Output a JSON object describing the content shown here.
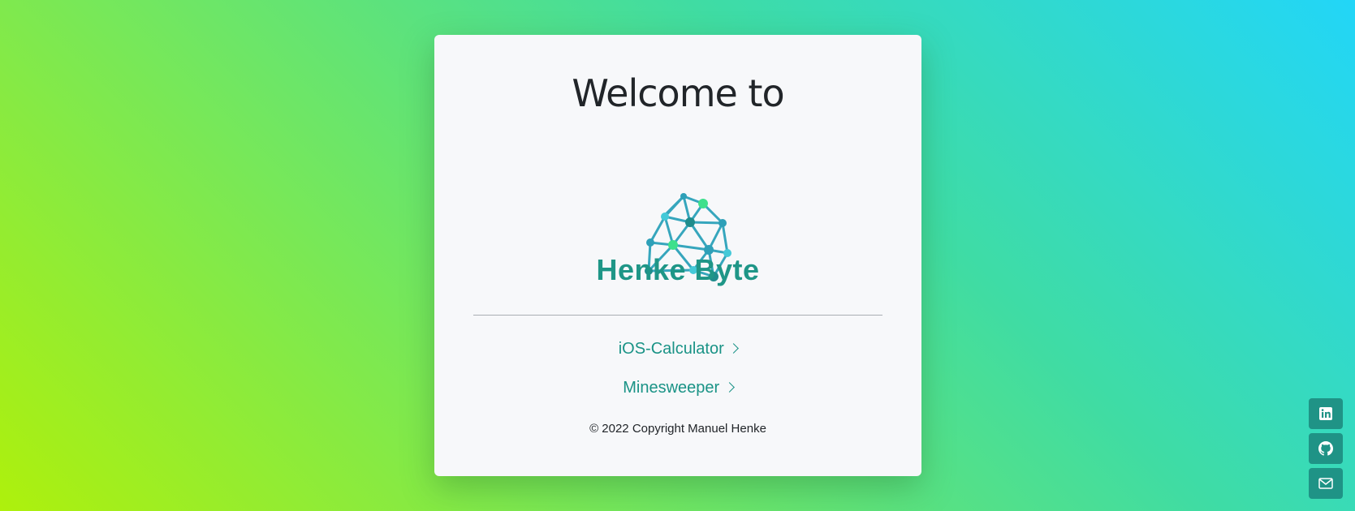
{
  "card": {
    "heading": "Welcome to",
    "brand_name": "Henke Byte",
    "logo_icon": "network-brain-icon",
    "links": [
      {
        "label": "iOS-Calculator",
        "icon": "chevron-right-icon"
      },
      {
        "label": "Minesweeper",
        "icon": "chevron-right-icon"
      }
    ],
    "copyright": "© 2022 Copyright Manuel Henke"
  },
  "social": [
    {
      "name": "linkedin",
      "icon": "linkedin-icon"
    },
    {
      "name": "github",
      "icon": "github-icon"
    },
    {
      "name": "email",
      "icon": "envelope-icon"
    }
  ],
  "colors": {
    "accent": "#1f9386",
    "brand_text": "#1f9687",
    "node_blue": "#2ea0b8",
    "node_green": "#3ee08c",
    "background_start": "#aef00c",
    "background_end": "#22d6f8"
  }
}
